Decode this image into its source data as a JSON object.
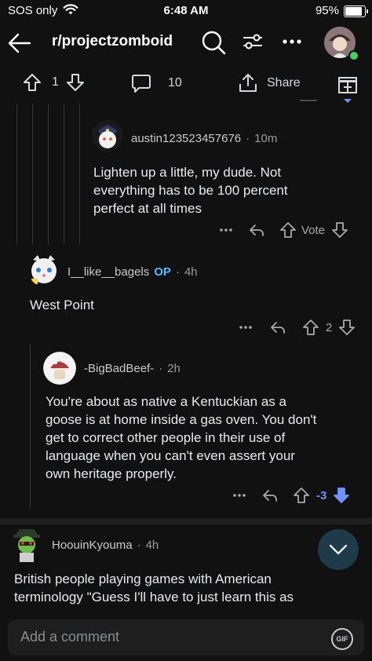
{
  "status_bar": {
    "carrier": "SOS only",
    "time": "6:48 AM",
    "battery": "95%"
  },
  "header": {
    "subreddit": "r/projectzomboid"
  },
  "post_bar": {
    "score": "1",
    "comments": "10",
    "share_label": "Share"
  },
  "comments": [
    {
      "author": "austin123523457676",
      "time": "10m",
      "body_lines": [
        "Lighten up a little, my dude. Not",
        "everything has to be 100 percent",
        "perfect at all times"
      ],
      "vote_label": "Vote"
    },
    {
      "author": "I__like__bagels",
      "op_badge": "OP",
      "time": "4h",
      "body_lines": [
        "West Point"
      ],
      "score": "2"
    },
    {
      "author": "-BigBadBeef-",
      "time": "2h",
      "body_lines": [
        "You're about as native a Kentuckian as a",
        "goose is at home inside a gas oven. You don't",
        "get to correct other people in their use of",
        "language when you can't even assert your",
        "own heritage properly."
      ],
      "score": "-3"
    },
    {
      "author": "HoouinKyouma",
      "time": "4h",
      "body_lines": [
        "British people playing games with American",
        "terminology \"Guess I'll have to just learn this as"
      ]
    }
  ],
  "comment_bar": {
    "placeholder": "Add a comment",
    "gif_label": "GIF"
  },
  "colors": {
    "background": "#111111",
    "op_blue": "#4fbcff",
    "downvote_active": "#7193ff",
    "online_green": "#46d160"
  }
}
